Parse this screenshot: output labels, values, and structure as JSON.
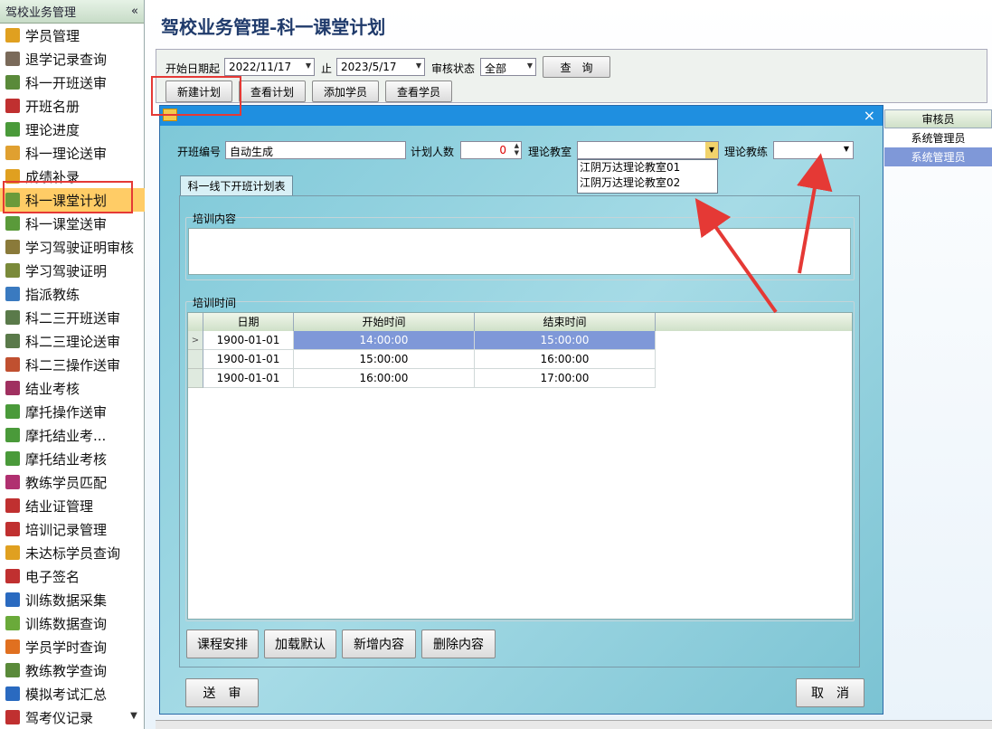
{
  "sidebar": {
    "title": "驾校业务管理",
    "collapse_icon": "«",
    "scroll_down_icon": "▼",
    "items": [
      {
        "label": "学员管理",
        "icon": "people-icon",
        "color": "#e0a020"
      },
      {
        "label": "退学记录查询",
        "icon": "person-icon",
        "color": "#7a6a5a"
      },
      {
        "label": "科一开班送审",
        "icon": "document-icon",
        "color": "#5a8a3a"
      },
      {
        "label": "开班名册",
        "icon": "book-icon",
        "color": "#c03030"
      },
      {
        "label": "理论进度",
        "icon": "chart-icon",
        "color": "#4a9a3a"
      },
      {
        "label": "科一理论送审",
        "icon": "form-icon",
        "color": "#e0a030"
      },
      {
        "label": "成绩补录",
        "icon": "folder-icon",
        "color": "#e0a020"
      },
      {
        "label": "科一课堂计划",
        "icon": "plan-icon",
        "color": "#6a9a3a"
      },
      {
        "label": "科一课堂送审",
        "icon": "form-icon",
        "color": "#5a9a3a"
      },
      {
        "label": "学习驾驶证明审核",
        "icon": "certificate-icon",
        "color": "#8a7a3a"
      },
      {
        "label": "学习驾驶证明",
        "icon": "certificate-icon",
        "color": "#7a8a3a"
      },
      {
        "label": "指派教练",
        "icon": "people-icon",
        "color": "#3a7ac0"
      },
      {
        "label": "科二三开班送审",
        "icon": "document-icon",
        "color": "#5a7a4a"
      },
      {
        "label": "科二三理论送审",
        "icon": "document-icon",
        "color": "#5a7a4a"
      },
      {
        "label": "科二三操作送审",
        "icon": "document-icon",
        "color": "#c05030"
      },
      {
        "label": "结业考核",
        "icon": "exam-icon",
        "color": "#a03060"
      },
      {
        "label": "摩托操作送审",
        "icon": "form-icon",
        "color": "#4a9a3a"
      },
      {
        "label": "摩托结业考...",
        "icon": "form-icon",
        "color": "#4a9a3a"
      },
      {
        "label": "摩托结业考核",
        "icon": "form-icon",
        "color": "#4a9a3a"
      },
      {
        "label": "教练学员匹配",
        "icon": "match-icon",
        "color": "#b03070"
      },
      {
        "label": "结业证管理",
        "icon": "list-icon",
        "color": "#c03030"
      },
      {
        "label": "培训记录管理",
        "icon": "list-icon",
        "color": "#c03030"
      },
      {
        "label": "未达标学员查询",
        "icon": "people-icon",
        "color": "#e0a020"
      },
      {
        "label": "电子签名",
        "icon": "list-icon",
        "color": "#c03030"
      },
      {
        "label": "训练数据采集",
        "icon": "monitor-icon",
        "color": "#2a6ac0"
      },
      {
        "label": "训练数据查询",
        "icon": "message-icon",
        "color": "#6aaa3a"
      },
      {
        "label": "学员学时查询",
        "icon": "magnifier-icon",
        "color": "#e07020"
      },
      {
        "label": "教练教学查询",
        "icon": "chart-icon",
        "color": "#5a8a3a"
      },
      {
        "label": "模拟考试汇总",
        "icon": "wheel-icon",
        "color": "#2a6ac0"
      },
      {
        "label": "驾考仪记录",
        "icon": "device-icon",
        "color": "#c03030"
      }
    ]
  },
  "page": {
    "title": "驾校业务管理-科一课堂计划"
  },
  "toolbar": {
    "start_date_label": "开始日期起",
    "start_date": "2022/11/17",
    "to_label": "止",
    "end_date": "2023/5/17",
    "status_label": "审核状态",
    "status_value": "全部",
    "query_button": "查　询",
    "new_plan_button": "新建计划",
    "view_plan_button": "查看计划",
    "add_student_button": "添加学员",
    "view_student_button": "查看学员"
  },
  "background_grid": {
    "header": "审核员",
    "rows": [
      "系统管理员",
      "系统管理员"
    ]
  },
  "dialog": {
    "close_icon": "×",
    "class_no_label": "开班编号",
    "class_no_value": "自动生成",
    "plan_count_label": "计划人数",
    "plan_count_value": "0",
    "classroom_label": "理论教室",
    "classroom_value": "",
    "coach_label": "理论教练",
    "coach_value": "",
    "classroom_options": [
      "江阴万达理论教室01",
      "江阴万达理论教室02"
    ],
    "tab_label": "科一线下开班计划表",
    "content_group_label": "培训内容",
    "content_value": "",
    "time_group_label": "培训时间",
    "grid": {
      "columns": [
        "日期",
        "开始时间",
        "结束时间"
      ],
      "rows": [
        {
          "date": "1900-01-01",
          "start": "14:00:00",
          "end": "15:00:00"
        },
        {
          "date": "1900-01-01",
          "start": "15:00:00",
          "end": "16:00:00"
        },
        {
          "date": "1900-01-01",
          "start": "16:00:00",
          "end": "17:00:00"
        }
      ]
    },
    "schedule_button": "课程安排",
    "load_default_button": "加载默认",
    "add_content_button": "新增内容",
    "delete_content_button": "删除内容",
    "submit_button": "送　审",
    "cancel_button": "取　消"
  }
}
